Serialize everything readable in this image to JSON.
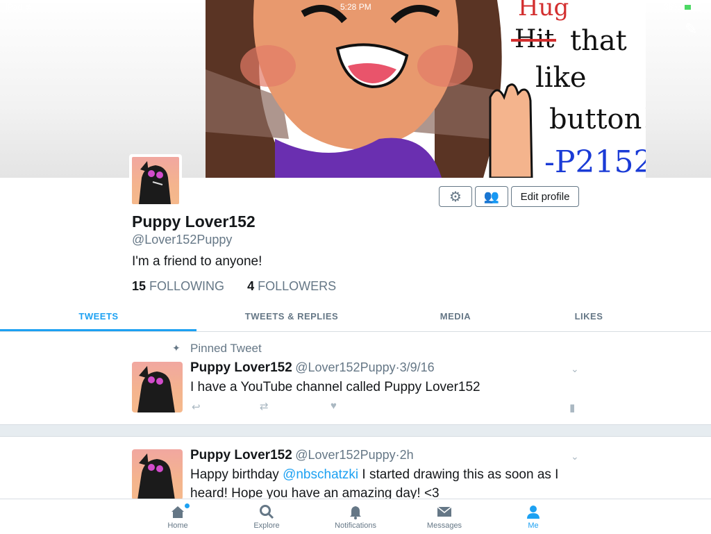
{
  "status_bar": {
    "device": "iPad",
    "time": "5:28 PM",
    "battery": "38%"
  },
  "banner": {
    "art_text_1": "Hug",
    "art_text_2": "Hit",
    "art_text_3": "that",
    "art_text_4": "like",
    "art_text_5": "button!",
    "art_text_6": "-P2152"
  },
  "profile": {
    "name": "Puppy Lover152",
    "handle": "@Lover152Puppy",
    "bio": "I'm a friend to anyone!",
    "following_count": "15",
    "following_label": "FOLLOWING",
    "followers_count": "4",
    "followers_label": "FOLLOWERS",
    "edit_profile_label": "Edit profile"
  },
  "tabs": [
    {
      "label": "TWEETS",
      "active": true
    },
    {
      "label": "TWEETS & REPLIES",
      "active": false
    },
    {
      "label": "MEDIA",
      "active": false
    },
    {
      "label": "LIKES",
      "active": false
    }
  ],
  "tweets": [
    {
      "pinned_label": "Pinned Tweet",
      "name": "Puppy Lover152",
      "handle": "@Lover152Puppy",
      "sep": "·",
      "date": "3/9/16",
      "text": "I have a YouTube channel called Puppy Lover152"
    },
    {
      "name": "Puppy Lover152",
      "handle": "@Lover152Puppy",
      "sep": "·",
      "date": "2h",
      "text_before": "Happy birthday ",
      "mention": "@nbschatzki",
      "text_after": " I started drawing this as soon as I heard! Hope you have an amazing day! <3"
    }
  ],
  "tab_bar": [
    {
      "label": "Home",
      "icon": "home-icon"
    },
    {
      "label": "Explore",
      "icon": "search-icon"
    },
    {
      "label": "Notifications",
      "icon": "bell-icon"
    },
    {
      "label": "Messages",
      "icon": "envelope-icon"
    },
    {
      "label": "Me",
      "icon": "person-icon"
    }
  ],
  "colors": {
    "accent": "#1da1f2",
    "muted": "#657786",
    "purple_shirt": "#6a2fb0"
  }
}
